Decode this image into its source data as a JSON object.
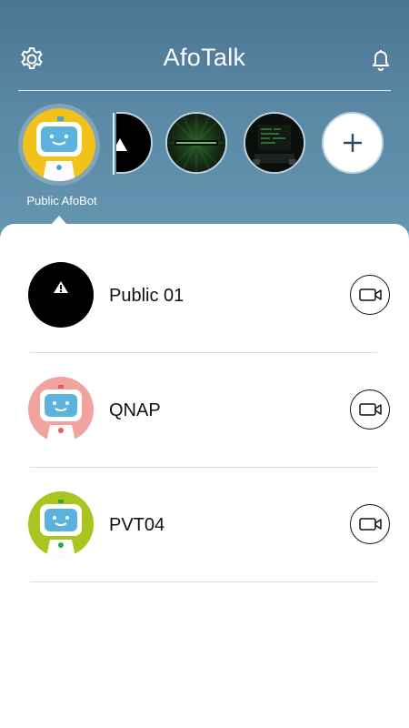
{
  "header": {
    "title": "AfoTalk",
    "settings_icon": "gear-icon",
    "notifications_icon": "bell-icon"
  },
  "carousel": {
    "selected": {
      "label": "Public AfoBot",
      "color": "#f2c21a"
    },
    "add_icon": "plus-icon"
  },
  "list": [
    {
      "name": "Public 01",
      "avatar": "warning-avatar",
      "action_icon": "video-camera-icon"
    },
    {
      "name": "QNAP",
      "avatar": "robot-avatar",
      "color": "#f0a39f",
      "action_icon": "video-camera-icon"
    },
    {
      "name": "PVT04",
      "avatar": "robot-avatar",
      "color": "#a8c520",
      "action_icon": "video-camera-icon"
    }
  ],
  "colors": {
    "header_gradient_top": "#4b7592",
    "header_gradient_bottom": "#6596b2",
    "robot_screen": "#5bb3dd"
  }
}
